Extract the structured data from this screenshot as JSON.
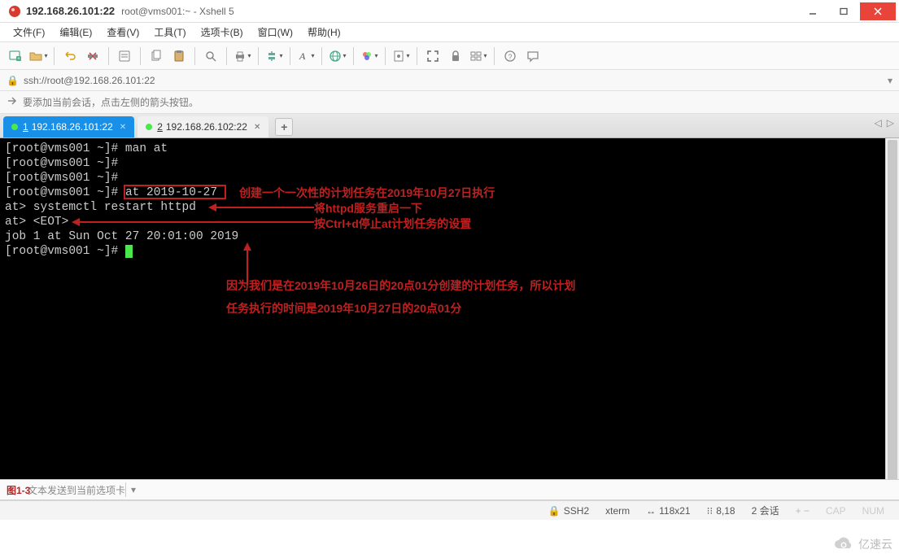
{
  "window": {
    "title": "192.168.26.101:22",
    "subtitle": "root@vms001:~ - Xshell 5"
  },
  "menu": {
    "file": "文件(F)",
    "edit": "编辑(E)",
    "view": "查看(V)",
    "tools": "工具(T)",
    "tab": "选项卡(B)",
    "window": "窗口(W)",
    "help": "帮助(H)"
  },
  "addressbar": {
    "url": "ssh://root@192.168.26.101:22"
  },
  "hint": {
    "text": "要添加当前会话，点击左侧的箭头按钮。"
  },
  "tabs": {
    "active": {
      "num": "1",
      "label": "192.168.26.101:22"
    },
    "inactive": {
      "num": "2",
      "label": "192.168.26.102:22"
    },
    "add": "+"
  },
  "terminal": {
    "l1": "[root@vms001 ~]# man at",
    "l2": "[root@vms001 ~]# ",
    "l3": "[root@vms001 ~]# ",
    "l4p": "[root@vms001 ~]# ",
    "l4c": "at 2019-10-27",
    "l5": "at> systemctl restart httpd",
    "l6": "at> <EOT>",
    "l7": "job 1 at Sun Oct 27 20:01:00 2019",
    "l8": "[root@vms001 ~]# "
  },
  "annotations": {
    "a1": "创建一个一次性的计划任务在2019年10月27日执行",
    "a2": "将httpd服务重启一下",
    "a3": "按Ctrl+d停止at计划任务的设置",
    "a4": "因为我们是在2019年10月26日的20点01分创建的计划任务，所以计划",
    "a5": "任务执行的时间是2019年10月27日的20点01分",
    "fig": "图1-3"
  },
  "inputbar": {
    "placeholder": "文本发送到当前选项卡"
  },
  "status": {
    "proto": "SSH2",
    "term": "xterm",
    "size": "118x21",
    "pos": "8,18",
    "sessions": "2 会话"
  },
  "watermark": {
    "text": "亿速云"
  },
  "icons": {
    "lock": "🔒",
    "arrow": "➪",
    "size_pre": "↔",
    "pos_pre": "⁝⁝",
    "plus_minus": "+ −",
    "caps": "CAP",
    "num": "NUM"
  }
}
